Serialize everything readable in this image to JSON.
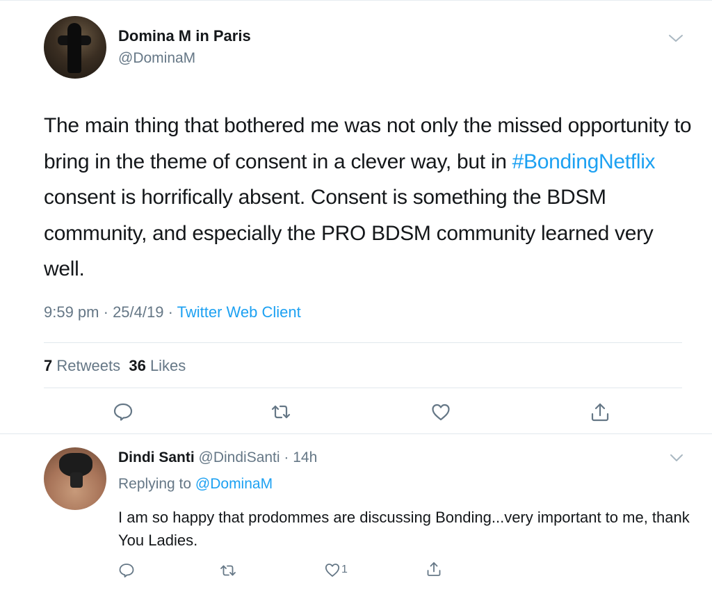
{
  "tweet": {
    "author_name": "Domina M in Paris",
    "author_handle": "@DominaM",
    "text_before": "The main thing that bothered me was not only the missed opportunity to bring in the theme of consent in a clever way, but in ",
    "hashtag": "#BondingNetflix",
    "text_after": " consent is horrifically absent. Consent is something the BDSM community, and especially the PRO BDSM community learned very well.",
    "time": "9:59 pm",
    "date": "25/4/19",
    "source": "Twitter Web Client",
    "retweets_count": "7",
    "retweets_label": "Retweets",
    "likes_count": "36",
    "likes_label": "Likes"
  },
  "reply": {
    "author_name": "Dindi Santi",
    "author_handle": "@DindiSanti",
    "age": "14h",
    "replying_label": "Replying to",
    "replying_to": "@DominaM",
    "text": "I am so happy that prodommes are discussing Bonding...very important to me, thank You Ladies.",
    "like_count": "1"
  },
  "icons": {
    "reply": "reply-icon",
    "retweet": "retweet-icon",
    "like": "heart-icon",
    "share": "share-icon",
    "menu": "chevron-down-icon"
  },
  "colors": {
    "accent": "#1da1f2",
    "secondary_text": "#657786",
    "primary_text": "#14171a",
    "divider": "#e1e8ed"
  }
}
